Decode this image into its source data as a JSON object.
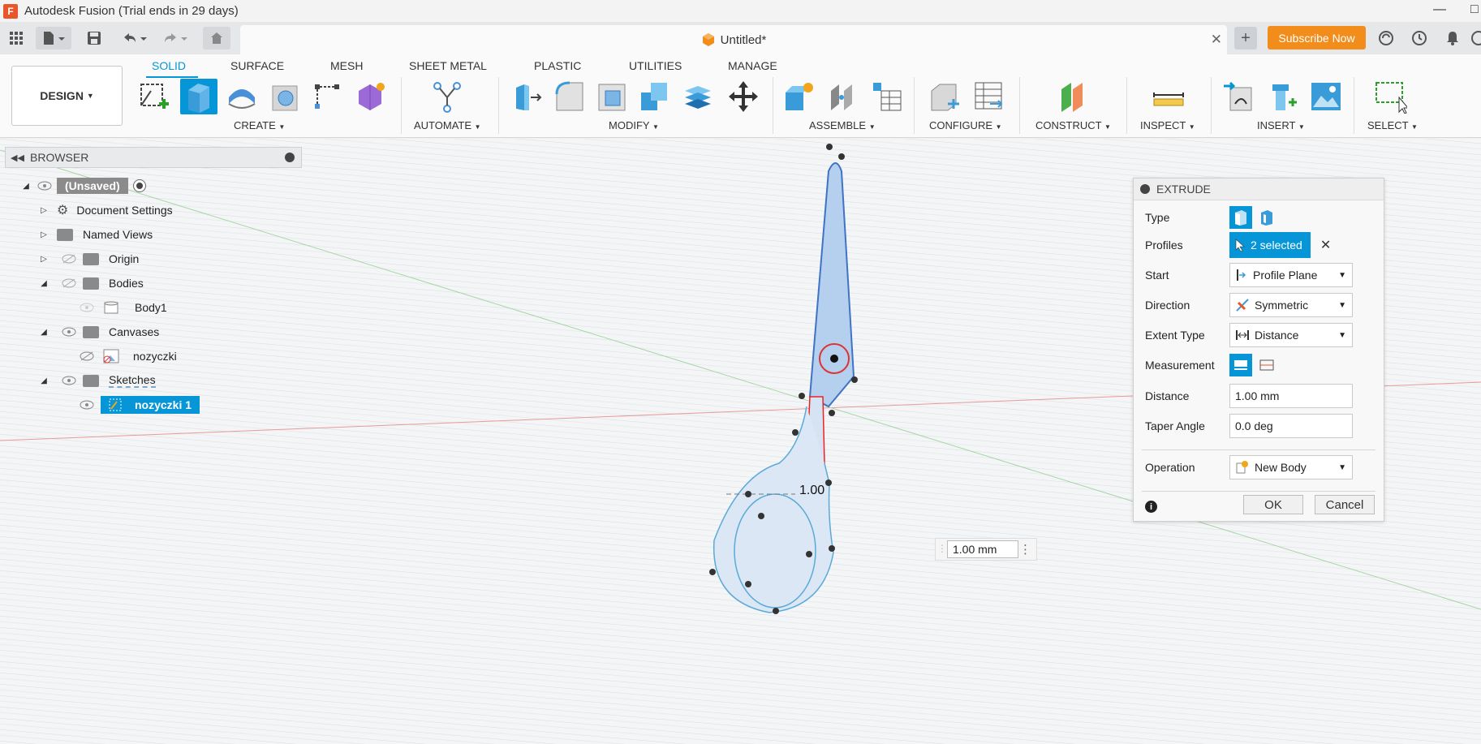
{
  "window": {
    "title": "Autodesk Fusion (Trial ends in 29 days)",
    "logo_letter": "F"
  },
  "tabbar": {
    "doc_title": "Untitled*",
    "subscribe_label": "Subscribe Now"
  },
  "ribbon": {
    "workspace": "DESIGN",
    "tabs": [
      "SOLID",
      "SURFACE",
      "MESH",
      "SHEET METAL",
      "PLASTIC",
      "UTILITIES",
      "MANAGE"
    ],
    "active_tab": "SOLID",
    "groups": [
      "CREATE",
      "AUTOMATE",
      "MODIFY",
      "ASSEMBLE",
      "CONFIGURE",
      "CONSTRUCT",
      "INSPECT",
      "INSERT",
      "SELECT"
    ]
  },
  "browser": {
    "title": "BROWSER",
    "items": [
      {
        "label": "(Unsaved)"
      },
      {
        "label": "Document Settings"
      },
      {
        "label": "Named Views"
      },
      {
        "label": "Origin"
      },
      {
        "label": "Bodies"
      },
      {
        "label": "Body1"
      },
      {
        "label": "Canvases"
      },
      {
        "label": "nozyczki"
      },
      {
        "label": "Sketches"
      },
      {
        "label": "nozyczki 1"
      }
    ]
  },
  "extrude": {
    "title": "EXTRUDE",
    "type_label": "Type",
    "profiles_label": "Profiles",
    "profiles_value": "2 selected",
    "start_label": "Start",
    "start_value": "Profile Plane",
    "direction_label": "Direction",
    "direction_value": "Symmetric",
    "extent_label": "Extent Type",
    "extent_value": "Distance",
    "measurement_label": "Measurement",
    "distance_label": "Distance",
    "distance_value": "1.00 mm",
    "taper_label": "Taper Angle",
    "taper_value": "0.0 deg",
    "operation_label": "Operation",
    "operation_value": "New Body",
    "ok_label": "OK",
    "cancel_label": "Cancel"
  },
  "viewport": {
    "float_distance": "1.00 mm",
    "dim_label": "1.00"
  },
  "colors": {
    "accent": "#0696d7",
    "subscribe": "#f28c1a",
    "sketch_fill": "#a9c8ec",
    "sketch_line": "#3f73c6"
  }
}
